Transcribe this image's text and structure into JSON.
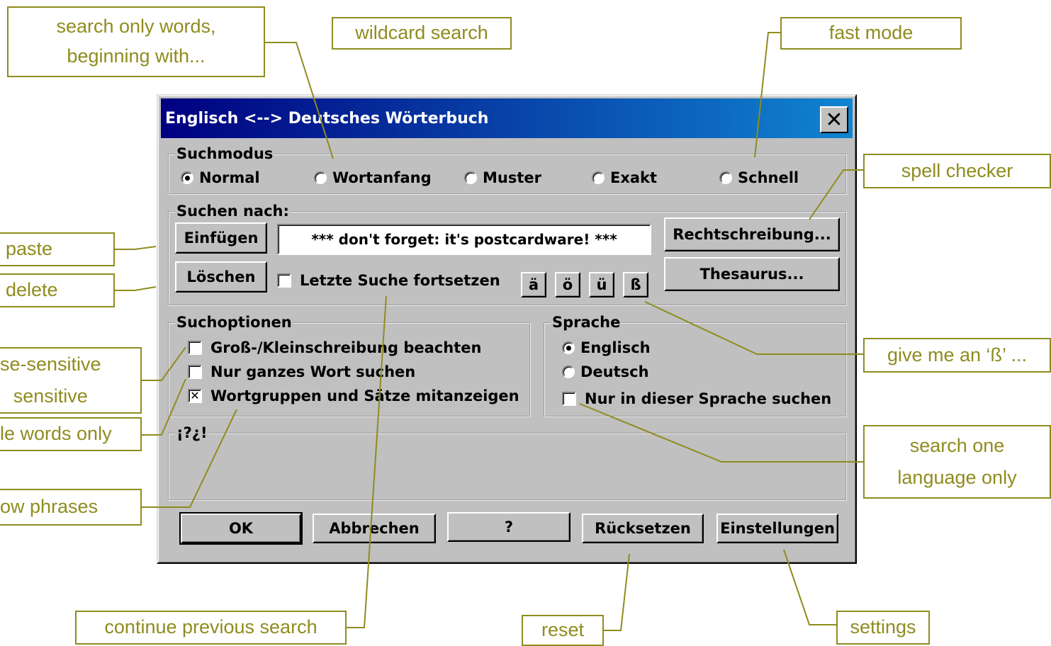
{
  "colors": {
    "annotation": "#8f8c1f",
    "dialog_face": "#c0c0c0",
    "titlebar_start": "#000080",
    "titlebar_end": "#1084d0"
  },
  "annotations": {
    "search_beginning": "search only words,\nbeginning with...",
    "wildcard": "wildcard search",
    "fast_mode": "fast mode",
    "spell_checker": "spell checker",
    "paste": "paste",
    "delete": "delete",
    "case_sensitive": "se-sensitive\n sensitive",
    "whole_words": "le words only",
    "show_phrases": "ow phrases",
    "give_sz": "give me an ‘ß’ ...",
    "one_language": "search one\nlanguage only",
    "continue_search": "continue previous search",
    "reset": "reset",
    "settings": "settings"
  },
  "dialog": {
    "title": "Englisch <--> Deutsches Wörterbuch",
    "close_label": "✕",
    "suchmodus": {
      "label": "Suchmodus",
      "options": [
        "Normal",
        "Wortanfang",
        "Muster",
        "Exakt",
        "Schnell"
      ],
      "selected": "Normal"
    },
    "suchen": {
      "label": "Suchen nach:",
      "paste_button": "Einfügen",
      "delete_button": "Löschen",
      "search_value": "*** don't forget: it's postcardware! ***",
      "continue_label": "Letzte Suche fortsetzen",
      "umlauts": [
        "ä",
        "ö",
        "ü",
        "ß"
      ],
      "spell_button": "Rechtschreibung...",
      "thesaurus_button": "Thesaurus..."
    },
    "suchoptionen": {
      "label": "Suchoptionen",
      "options": [
        {
          "label": "Groß-/Kleinschreibung beachten",
          "checked": false
        },
        {
          "label": "Nur ganzes Wort suchen",
          "checked": false
        },
        {
          "label": "Wortgruppen und Sätze mitanzeigen",
          "checked": true
        }
      ]
    },
    "sprache": {
      "label": "Sprache",
      "options": [
        "Englisch",
        "Deutsch"
      ],
      "selected": "Englisch",
      "only_this_language": "Nur in dieser Sprache suchen"
    },
    "result_group_label": "¡?¿!",
    "buttons": {
      "ok": "OK",
      "cancel": "Abbrechen",
      "help": "?",
      "reset": "Rücksetzen",
      "settings": "Einstellungen"
    }
  }
}
